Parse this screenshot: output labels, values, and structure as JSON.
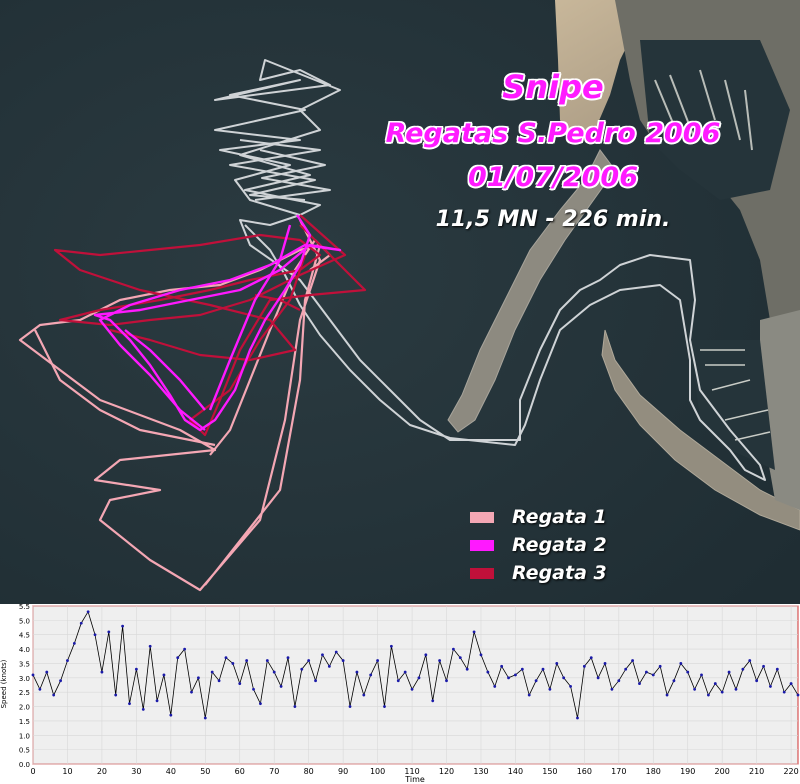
{
  "title": {
    "line1": "Snipe",
    "line2": "Regatas S.Pedro 2006",
    "line3": "01/07/2006",
    "line4": "11,5 MN - 226 min."
  },
  "colors": {
    "regata1": "#f4a7b4",
    "regata2": "#ff19ff",
    "regata3": "#c0103a",
    "transit": "#cfd3d6",
    "speed_line": "#000000",
    "speed_points": "#1a1aa8",
    "chart_frame": "#d03030",
    "title_pink": "#ff1aff"
  },
  "legend": [
    {
      "label": "Regata 1",
      "color": "#f4a7b4"
    },
    {
      "label": "Regata 2",
      "color": "#ff19ff"
    },
    {
      "label": "Regata 3",
      "color": "#c0103a"
    }
  ],
  "chart_data": {
    "type": "line",
    "xlabel": "Time",
    "ylabel": "Speed (knots)",
    "xlim": [
      0,
      222
    ],
    "ylim": [
      0,
      5.5
    ],
    "xticks": [
      0,
      10,
      20,
      30,
      40,
      50,
      60,
      70,
      80,
      90,
      100,
      110,
      120,
      130,
      140,
      150,
      160,
      170,
      180,
      190,
      200,
      210,
      220
    ],
    "yticks": [
      0.0,
      0.5,
      1.0,
      1.5,
      2.0,
      2.5,
      3.0,
      3.5,
      4.0,
      4.5,
      5.0,
      5.5
    ],
    "grid": true,
    "series": [
      {
        "x": [
          0,
          2,
          4,
          6,
          8,
          10,
          12,
          14,
          16,
          18,
          20,
          22,
          24,
          26,
          28,
          30,
          32,
          34,
          36,
          38,
          40,
          42,
          44,
          46,
          48,
          50,
          52,
          54,
          56,
          58,
          60,
          62,
          64,
          66,
          68,
          70,
          72,
          74,
          76,
          78,
          80,
          82,
          84,
          86,
          88,
          90,
          92,
          94,
          96,
          98,
          100,
          102,
          104,
          106,
          108,
          110,
          112,
          114,
          116,
          118,
          120,
          122,
          124,
          126,
          128,
          130,
          132,
          134,
          136,
          138,
          140,
          142,
          144,
          146,
          148,
          150,
          152,
          154,
          156,
          158,
          160,
          162,
          164,
          166,
          168,
          170,
          172,
          174,
          176,
          178,
          180,
          182,
          184,
          186,
          188,
          190,
          192,
          194,
          196,
          198,
          200,
          202,
          204,
          206,
          208,
          210,
          212,
          214,
          216,
          218,
          220,
          222
        ],
        "y": [
          3.1,
          2.6,
          3.2,
          2.4,
          2.9,
          3.6,
          4.2,
          4.9,
          5.3,
          4.5,
          3.2,
          4.6,
          2.4,
          4.8,
          2.1,
          3.3,
          1.9,
          4.1,
          2.2,
          3.1,
          1.7,
          3.7,
          4.0,
          2.5,
          3.0,
          1.6,
          3.2,
          2.9,
          3.7,
          3.5,
          2.8,
          3.6,
          2.6,
          2.1,
          3.6,
          3.2,
          2.7,
          3.7,
          2.0,
          3.3,
          3.6,
          2.9,
          3.8,
          3.4,
          3.9,
          3.6,
          2.0,
          3.2,
          2.4,
          3.1,
          3.6,
          2.0,
          4.1,
          2.9,
          3.2,
          2.6,
          3.0,
          3.8,
          2.2,
          3.6,
          2.9,
          4.0,
          3.7,
          3.3,
          4.6,
          3.8,
          3.2,
          2.7,
          3.4,
          3.0,
          3.1,
          3.3,
          2.4,
          2.9,
          3.3,
          2.6,
          3.5,
          3.0,
          2.7,
          1.6,
          3.4,
          3.7,
          3.0,
          3.5,
          2.6,
          2.9,
          3.3,
          3.6,
          2.8,
          3.2,
          3.1,
          3.4,
          2.4,
          2.9,
          3.5,
          3.2,
          2.6,
          3.1,
          2.4,
          2.8,
          2.5,
          3.2,
          2.6,
          3.3,
          3.6,
          2.9,
          3.4,
          2.7,
          3.3,
          2.5,
          2.8,
          2.4
        ]
      }
    ]
  }
}
